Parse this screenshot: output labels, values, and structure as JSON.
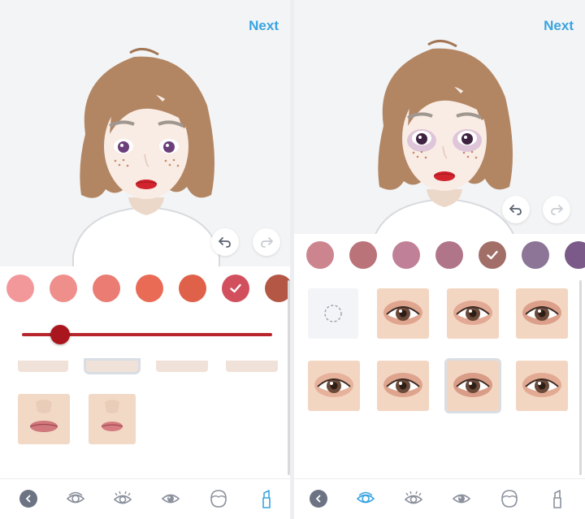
{
  "left_panel": {
    "next_label": "Next",
    "lip_colors": [
      "#f3989a",
      "#ef8f8b",
      "#ea7c74",
      "#e96b55",
      "#df614a",
      "#d2505d",
      "#b45744"
    ],
    "selected_color_index": 5,
    "intensity": 0.16,
    "lip_styles": [
      "lip-style-1",
      "lip-style-2"
    ]
  },
  "right_panel": {
    "next_label": "Next",
    "eye_colors": [
      "#cc858f",
      "#bb737a",
      "#c08198",
      "#b07589",
      "#a26f68",
      "#8c7596",
      "#7b5a89"
    ],
    "selected_color_index": 4,
    "selected_tile_index": 6,
    "eye_tiles": [
      "none",
      "eye-1",
      "eye-2",
      "eye-3",
      "eye-4",
      "eye-5",
      "eye-6",
      "eye-7"
    ]
  },
  "bottom_nav": {
    "items": [
      "back",
      "eyeshadow",
      "eyelashes",
      "eyes",
      "face",
      "lips"
    ],
    "left_active": "lips",
    "right_active": "eyeshadow"
  },
  "colors": {
    "accent_blue": "#3aa4e0",
    "lip_red": "#b7262c",
    "icon_gray": "#8a909c"
  }
}
